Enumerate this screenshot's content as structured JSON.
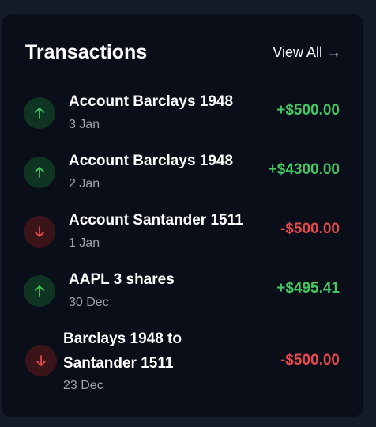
{
  "card": {
    "title": "Transactions",
    "view_all": "View All",
    "view_all_arrow": "→"
  },
  "colors": {
    "positive": "#43c564",
    "negative": "#e5484d",
    "card_bg": "#0a0e18"
  },
  "transactions": [
    {
      "direction": "up",
      "icon": "arrow-up-icon",
      "line1": "Account Barclays 1948",
      "line2": "",
      "date": "3 Jan",
      "amount": "+$500.00"
    },
    {
      "direction": "up",
      "icon": "arrow-up-icon",
      "line1": "Account Barclays 1948",
      "line2": "",
      "date": "2 Jan",
      "amount": "+$4300.00"
    },
    {
      "direction": "down",
      "icon": "arrow-down-icon",
      "line1": "Account Santander 1511",
      "line2": "",
      "date": "1 Jan",
      "amount": "-$500.00"
    },
    {
      "direction": "up",
      "icon": "arrow-up-icon",
      "line1": "AAPL 3 shares",
      "line2": "",
      "date": "30 Dec",
      "amount": "+$495.41"
    },
    {
      "direction": "down",
      "icon": "arrow-down-icon",
      "line1": "Barclays 1948 to",
      "line2": "Santander 1511",
      "date": "23 Dec",
      "amount": "-$500.00"
    }
  ]
}
